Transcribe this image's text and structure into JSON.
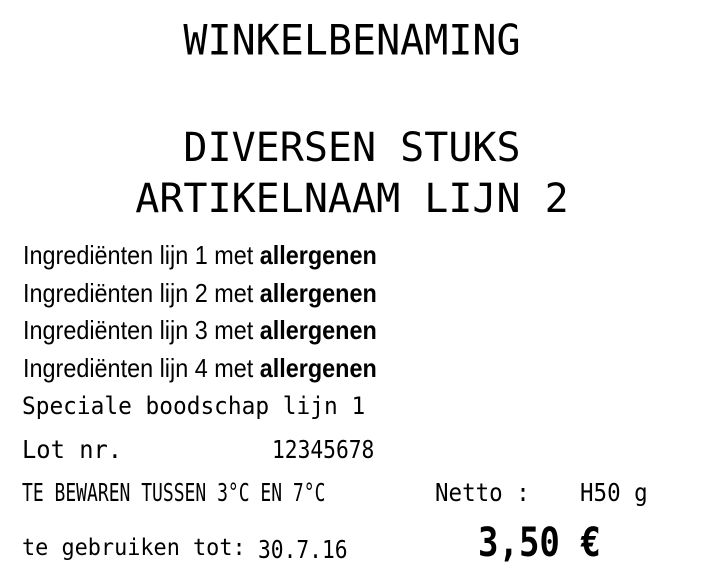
{
  "label": {
    "store_name": "WINKELBENAMING",
    "article_name_line1": "DIVERSEN STUKS",
    "article_name_line2": "ARTIKELNAAM LIJN 2",
    "ingredients": [
      {
        "text": "Ingrediënten lijn 1 met ",
        "allergen": "allergenen"
      },
      {
        "text": "Ingrediënten lijn 2 met ",
        "allergen": "allergenen"
      },
      {
        "text": "Ingrediënten lijn 3 met ",
        "allergen": "allergenen"
      },
      {
        "text": "Ingrediënten lijn 4 met ",
        "allergen": "allergenen"
      }
    ],
    "special_message": "Speciale boodschap lijn 1",
    "lot_label": "Lot nr.",
    "lot_value": "12345678",
    "storage_text": "TE BEWAREN TUSSEN 3°C EN 7°C",
    "netto_label": "Netto :",
    "netto_value": "H50 g",
    "best_before_label": "te gebruiken tot:",
    "best_before_value": "30.7.16",
    "price": "3,50 €"
  }
}
